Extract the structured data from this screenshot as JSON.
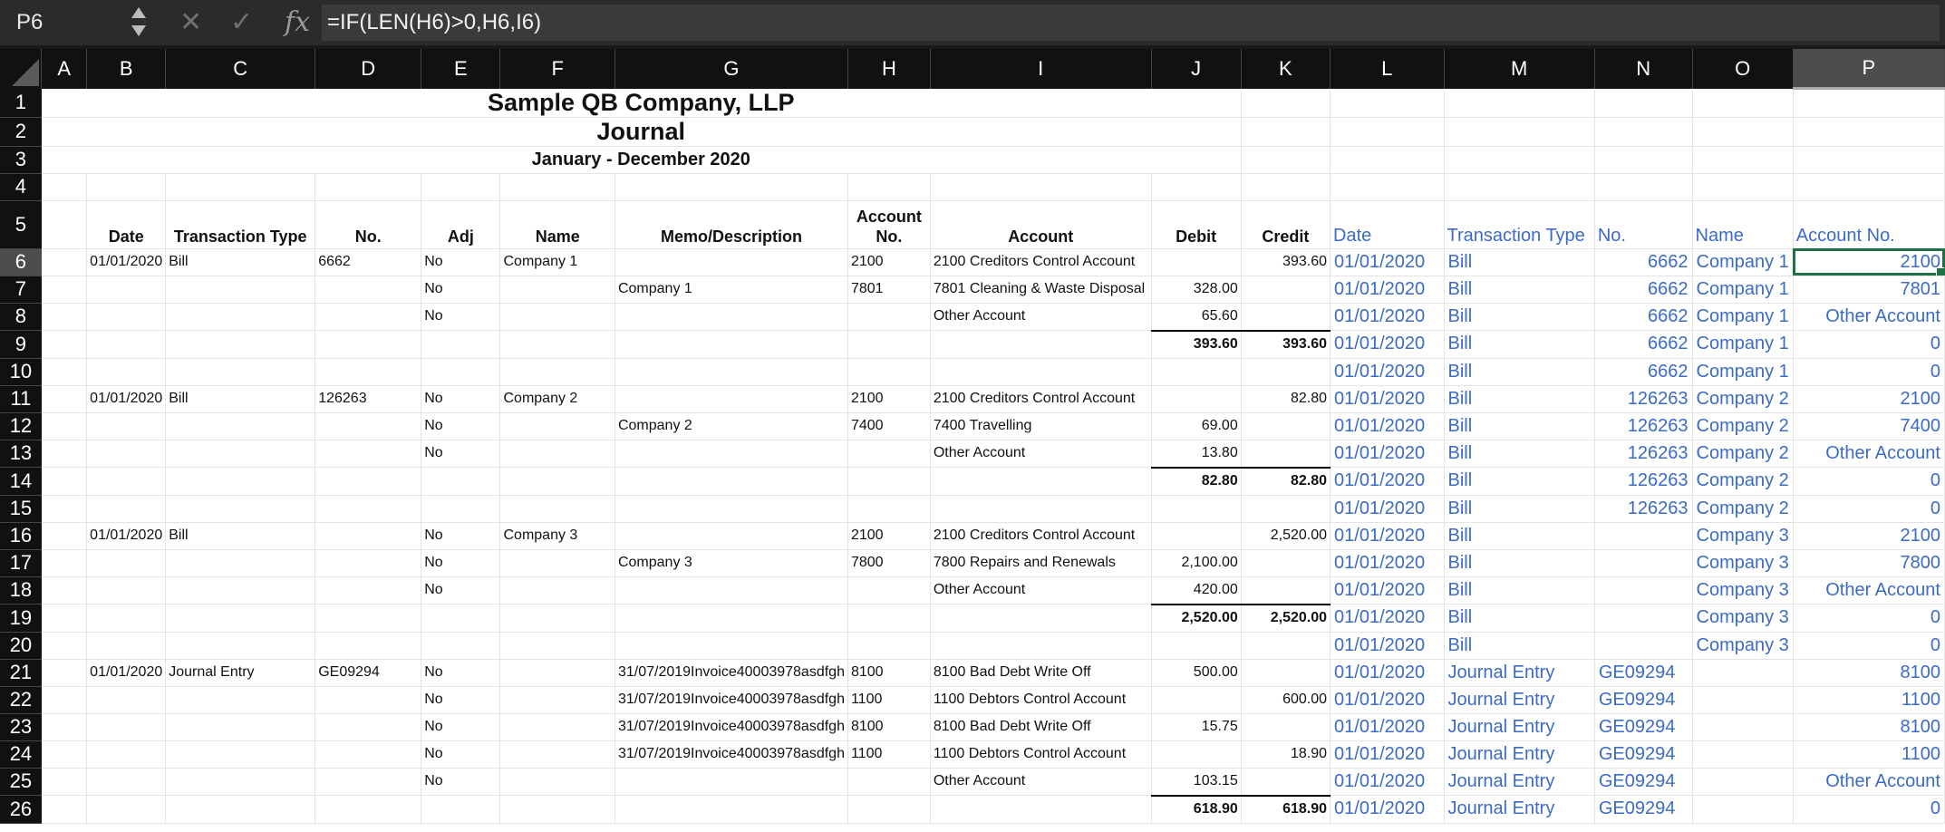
{
  "formula_bar": {
    "name_box": "P6",
    "cancel_icon": "cancel-icon",
    "enter_icon": "confirm-icon",
    "fx_label": "fx",
    "formula": "=IF(LEN(H6)>0,H6,I6)"
  },
  "columns": [
    "A",
    "B",
    "C",
    "D",
    "E",
    "F",
    "G",
    "H",
    "I",
    "J",
    "K",
    "L",
    "M",
    "N",
    "O",
    "P"
  ],
  "selected_cell": "P6",
  "header": {
    "company": "Sample QB Company, LLP",
    "report": "Journal",
    "period": "January - December 2020"
  },
  "col_headers": {
    "date": "Date",
    "transaction_type": "Transaction Type",
    "no": "No.",
    "adj": "Adj",
    "name": "Name",
    "memo": "Memo/Description",
    "account_no_1": "Account",
    "account_no_2": "No.",
    "account": "Account",
    "debit": "Debit",
    "credit": "Credit",
    "l": "Date",
    "m": "Transaction Type",
    "n": "No.",
    "o": "Name",
    "p": "Account No."
  },
  "rows": [
    {
      "n": "6",
      "B": "01/01/2020",
      "C": "Bill",
      "D": "6662",
      "E": "No",
      "F": "Company 1",
      "G": "",
      "H": "2100",
      "I": "2100 Creditors Control Account",
      "J": "",
      "K": "393.60",
      "L": "01/01/2020",
      "M": "Bill",
      "N": "6662",
      "O": "Company 1",
      "P": "2100"
    },
    {
      "n": "7",
      "B": "",
      "C": "",
      "D": "",
      "E": "No",
      "F": "",
      "G": "Company 1",
      "H": "7801",
      "I": "7801 Cleaning & Waste Disposal",
      "J": "328.00",
      "K": "",
      "L": "01/01/2020",
      "M": "Bill",
      "N": "6662",
      "O": "Company 1",
      "P": "7801"
    },
    {
      "n": "8",
      "B": "",
      "C": "",
      "D": "",
      "E": "No",
      "F": "",
      "G": "",
      "H": "",
      "I": "Other Account",
      "J": "65.60",
      "K": "",
      "L": "01/01/2020",
      "M": "Bill",
      "N": "6662",
      "O": "Company 1",
      "P": "Other Account"
    },
    {
      "n": "9",
      "B": "",
      "C": "",
      "D": "",
      "E": "",
      "F": "",
      "G": "",
      "H": "",
      "I": "",
      "J": "393.60",
      "K": "393.60",
      "L": "01/01/2020",
      "M": "Bill",
      "N": "6662",
      "O": "Company 1",
      "P": "0",
      "total": true
    },
    {
      "n": "10",
      "B": "",
      "C": "",
      "D": "",
      "E": "",
      "F": "",
      "G": "",
      "H": "",
      "I": "",
      "J": "",
      "K": "",
      "L": "01/01/2020",
      "M": "Bill",
      "N": "6662",
      "O": "Company 1",
      "P": "0"
    },
    {
      "n": "11",
      "B": "01/01/2020",
      "C": "Bill",
      "D": "126263",
      "E": "No",
      "F": "Company 2",
      "G": "",
      "H": "2100",
      "I": "2100 Creditors Control Account",
      "J": "",
      "K": "82.80",
      "L": "01/01/2020",
      "M": "Bill",
      "N": "126263",
      "O": "Company 2",
      "P": "2100"
    },
    {
      "n": "12",
      "B": "",
      "C": "",
      "D": "",
      "E": "No",
      "F": "",
      "G": "Company 2",
      "H": "7400",
      "I": "7400 Travelling",
      "J": "69.00",
      "K": "",
      "L": "01/01/2020",
      "M": "Bill",
      "N": "126263",
      "O": "Company 2",
      "P": "7400"
    },
    {
      "n": "13",
      "B": "",
      "C": "",
      "D": "",
      "E": "No",
      "F": "",
      "G": "",
      "H": "",
      "I": "Other Account",
      "J": "13.80",
      "K": "",
      "L": "01/01/2020",
      "M": "Bill",
      "N": "126263",
      "O": "Company 2",
      "P": "Other Account"
    },
    {
      "n": "14",
      "B": "",
      "C": "",
      "D": "",
      "E": "",
      "F": "",
      "G": "",
      "H": "",
      "I": "",
      "J": "82.80",
      "K": "82.80",
      "L": "01/01/2020",
      "M": "Bill",
      "N": "126263",
      "O": "Company 2",
      "P": "0",
      "total": true
    },
    {
      "n": "15",
      "B": "",
      "C": "",
      "D": "",
      "E": "",
      "F": "",
      "G": "",
      "H": "",
      "I": "",
      "J": "",
      "K": "",
      "L": "01/01/2020",
      "M": "Bill",
      "N": "126263",
      "O": "Company 2",
      "P": "0"
    },
    {
      "n": "16",
      "B": "01/01/2020",
      "C": "Bill",
      "D": "",
      "E": "No",
      "F": "Company 3",
      "G": "",
      "H": "2100",
      "I": "2100 Creditors Control Account",
      "J": "",
      "K": "2,520.00",
      "L": "01/01/2020",
      "M": "Bill",
      "N": "",
      "O": "Company 3",
      "P": "2100"
    },
    {
      "n": "17",
      "B": "",
      "C": "",
      "D": "",
      "E": "No",
      "F": "",
      "G": "Company 3",
      "H": "7800",
      "I": "7800 Repairs and Renewals",
      "J": "2,100.00",
      "K": "",
      "L": "01/01/2020",
      "M": "Bill",
      "N": "",
      "O": "Company 3",
      "P": "7800"
    },
    {
      "n": "18",
      "B": "",
      "C": "",
      "D": "",
      "E": "No",
      "F": "",
      "G": "",
      "H": "",
      "I": "Other Account",
      "J": "420.00",
      "K": "",
      "L": "01/01/2020",
      "M": "Bill",
      "N": "",
      "O": "Company 3",
      "P": "Other Account"
    },
    {
      "n": "19",
      "B": "",
      "C": "",
      "D": "",
      "E": "",
      "F": "",
      "G": "",
      "H": "",
      "I": "",
      "J": "2,520.00",
      "K": "2,520.00",
      "L": "01/01/2020",
      "M": "Bill",
      "N": "",
      "O": "Company 3",
      "P": "0",
      "total": true
    },
    {
      "n": "20",
      "B": "",
      "C": "",
      "D": "",
      "E": "",
      "F": "",
      "G": "",
      "H": "",
      "I": "",
      "J": "",
      "K": "",
      "L": "01/01/2020",
      "M": "Bill",
      "N": "",
      "O": "Company 3",
      "P": "0"
    },
    {
      "n": "21",
      "B": "01/01/2020",
      "C": "Journal Entry",
      "D": "GE09294",
      "E": "No",
      "F": "",
      "G": "31/07/2019Invoice40003978asdfgh",
      "H": "8100",
      "I": "8100 Bad Debt Write Off",
      "J": "500.00",
      "K": "",
      "L": "01/01/2020",
      "M": "Journal Entry",
      "N": "GE09294",
      "O": "",
      "P": "8100"
    },
    {
      "n": "22",
      "B": "",
      "C": "",
      "D": "",
      "E": "No",
      "F": "",
      "G": "31/07/2019Invoice40003978asdfgh",
      "H": "1100",
      "I": "1100 Debtors Control Account",
      "J": "",
      "K": "600.00",
      "L": "01/01/2020",
      "M": "Journal Entry",
      "N": "GE09294",
      "O": "",
      "P": "1100"
    },
    {
      "n": "23",
      "B": "",
      "C": "",
      "D": "",
      "E": "No",
      "F": "",
      "G": "31/07/2019Invoice40003978asdfgh",
      "H": "8100",
      "I": "8100 Bad Debt Write Off",
      "J": "15.75",
      "K": "",
      "L": "01/01/2020",
      "M": "Journal Entry",
      "N": "GE09294",
      "O": "",
      "P": "8100"
    },
    {
      "n": "24",
      "B": "",
      "C": "",
      "D": "",
      "E": "No",
      "F": "",
      "G": "31/07/2019Invoice40003978asdfgh",
      "H": "1100",
      "I": "1100 Debtors Control Account",
      "J": "",
      "K": "18.90",
      "L": "01/01/2020",
      "M": "Journal Entry",
      "N": "GE09294",
      "O": "",
      "P": "1100"
    },
    {
      "n": "25",
      "B": "",
      "C": "",
      "D": "",
      "E": "No",
      "F": "",
      "G": "",
      "H": "",
      "I": "Other Account",
      "J": "103.15",
      "K": "",
      "L": "01/01/2020",
      "M": "Journal Entry",
      "N": "GE09294",
      "O": "",
      "P": "Other Account"
    },
    {
      "n": "26",
      "B": "",
      "C": "",
      "D": "",
      "E": "",
      "F": "",
      "G": "",
      "H": "",
      "I": "",
      "J": "618.90",
      "K": "618.90",
      "L": "01/01/2020",
      "M": "Journal Entry",
      "N": "GE09294",
      "O": "",
      "P": "0",
      "total": true
    }
  ]
}
